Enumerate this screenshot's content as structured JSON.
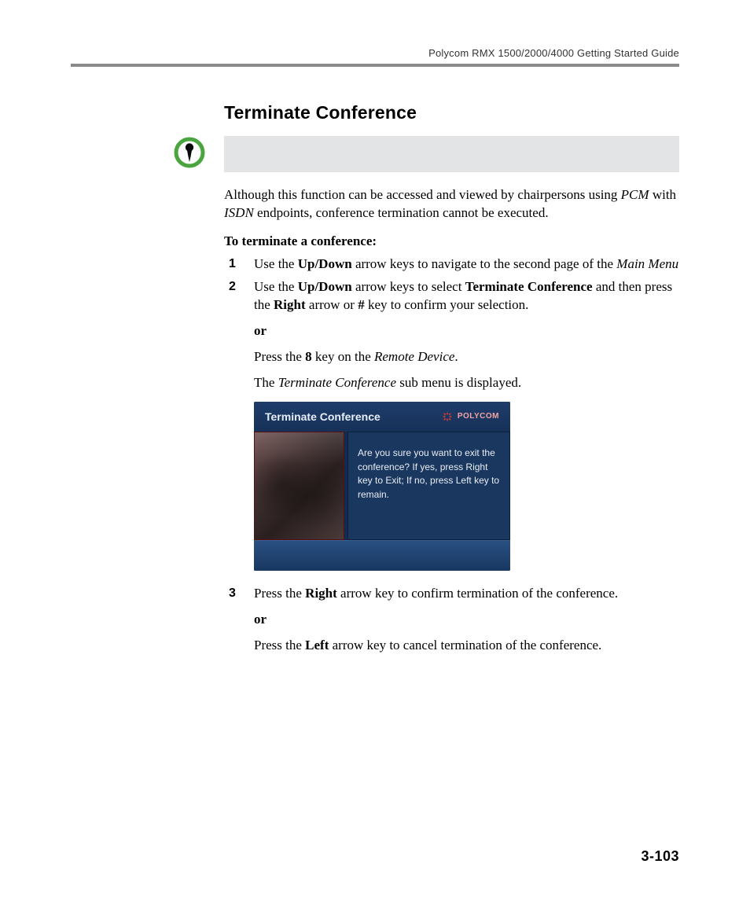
{
  "header": {
    "running_head": "Polycom RMX 1500/2000/4000 Getting Started Guide"
  },
  "section": {
    "title": "Terminate Conference"
  },
  "intro": {
    "t1": "Although this function can be accessed and viewed by chairpersons using ",
    "pcm": "PCM",
    "t2": " with ",
    "isdn": "ISDN",
    "t3": " endpoints, conference termination cannot be executed."
  },
  "lead": "To terminate a conference:",
  "steps": {
    "s1": {
      "a": "Use the ",
      "b": "Up/Down",
      "c": " arrow keys to navigate to the second page of the ",
      "d": "Main Menu"
    },
    "s2": {
      "a": "Use the ",
      "b": "Up/Down",
      "c": " arrow keys to select ",
      "d": "Terminate Conference",
      "e": " and then press the ",
      "f": "Right",
      "g": " arrow or ",
      "h": "#",
      "i": " key to confirm your selection.",
      "or": "or",
      "p2a": "Press the ",
      "p2b": "8",
      "p2c": " key on the ",
      "p2d": "Remote Device",
      "p2e": ".",
      "p3a": "The ",
      "p3b": "Terminate Conference",
      "p3c": " sub menu is displayed."
    },
    "s3": {
      "a": "Press the ",
      "b": "Right",
      "c": " arrow key to confirm termination of the conference.",
      "or": "or",
      "d": "Press the ",
      "e": "Left",
      "f": " arrow key to cancel termination of the conference."
    }
  },
  "screenshot": {
    "title": "Terminate Conference",
    "brand": "POLYCOM",
    "message": "Are you sure you want to exit the conference? If yes, press Right key to Exit; If no, press Left key to remain."
  },
  "page_number": "3-103"
}
